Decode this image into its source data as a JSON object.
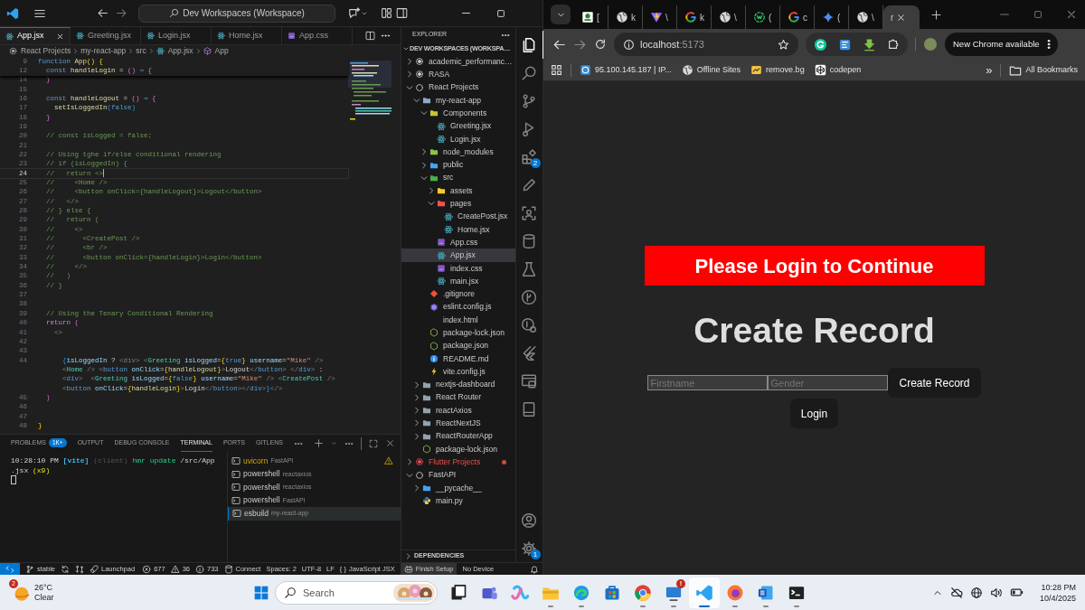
{
  "vscode": {
    "command_center": "Dev Workspaces (Workspace)",
    "tabs": [
      {
        "label": "App.jsx",
        "kind": "react",
        "selected": true
      },
      {
        "label": "Greeting.jsx",
        "kind": "react",
        "selected": false
      },
      {
        "label": "Login.jsx",
        "kind": "react",
        "selected": false
      },
      {
        "label": "Home.jsx",
        "kind": "react",
        "selected": false
      },
      {
        "label": "App.css",
        "kind": "css",
        "selected": false
      }
    ],
    "breadcrumb": [
      {
        "label": "React Projects",
        "kind": "target"
      },
      {
        "label": "my-react-app",
        "kind": "none"
      },
      {
        "label": "src",
        "kind": "none"
      },
      {
        "label": "App.jsx",
        "kind": "react"
      },
      {
        "label": "App",
        "kind": "component"
      }
    ],
    "sticky_lines": [
      {
        "num": "9",
        "current": false,
        "tokens": [
          {
            "text": "function ",
            "kind": "keyword"
          },
          {
            "text": "App",
            "kind": "function"
          },
          {
            "text": "() ",
            "kind": "gold"
          },
          {
            "text": "{",
            "kind": "gold"
          }
        ]
      },
      {
        "num": "12",
        "current": false,
        "tokens": [
          {
            "text": "  const ",
            "kind": "keyword"
          },
          {
            "text": "handleLogin",
            "kind": "function"
          },
          {
            "text": " = ",
            "kind": "plain"
          },
          {
            "text": "() ",
            "kind": "pink"
          },
          {
            "text": "⇒ ",
            "kind": "keyword"
          },
          {
            "text": "{",
            "kind": "pink"
          }
        ]
      }
    ],
    "code_lines": [
      {
        "num": "14",
        "current": false,
        "tokens": [
          {
            "text": "  }",
            "kind": "pink"
          }
        ]
      },
      {
        "num": "15",
        "current": false
      },
      {
        "num": "16",
        "current": false,
        "tokens": [
          {
            "text": "  const ",
            "kind": "keyword"
          },
          {
            "text": "handleLogout",
            "kind": "function"
          },
          {
            "text": " = ",
            "kind": "plain"
          },
          {
            "text": "() ",
            "kind": "pink"
          },
          {
            "text": "⇒ ",
            "kind": "keyword"
          },
          {
            "text": "{",
            "kind": "pink"
          }
        ]
      },
      {
        "num": "17",
        "current": false,
        "tokens": [
          {
            "text": "    setIsLoggedIn",
            "kind": "function"
          },
          {
            "text": "(",
            "kind": "blue"
          },
          {
            "text": "false",
            "kind": "keyword"
          },
          {
            "text": ")",
            "kind": "blue"
          }
        ]
      },
      {
        "num": "18",
        "current": false,
        "tokens": [
          {
            "text": "  }",
            "kind": "pink"
          }
        ]
      },
      {
        "num": "19",
        "current": false
      },
      {
        "num": "20",
        "current": false,
        "tokens": [
          {
            "text": "  // const isLogged = false;",
            "kind": "comment"
          }
        ]
      },
      {
        "num": "21",
        "current": false
      },
      {
        "num": "22",
        "current": false,
        "tokens": [
          {
            "text": "  // Using tghe if/else conditional rendering",
            "kind": "comment"
          }
        ]
      },
      {
        "num": "23",
        "current": false,
        "tokens": [
          {
            "text": "  // if (isLoggedIn) {",
            "kind": "comment"
          }
        ]
      },
      {
        "num": "24",
        "current": true,
        "tokens": [
          {
            "text": "  //   return <>",
            "kind": "comment"
          }
        ]
      },
      {
        "num": "25",
        "current": false,
        "tokens": [
          {
            "text": "  //     <Home />",
            "kind": "comment"
          }
        ]
      },
      {
        "num": "26",
        "current": false,
        "tokens": [
          {
            "text": "  //     <button onClick={handleLogout}>Logout</button>",
            "kind": "comment"
          }
        ]
      },
      {
        "num": "27",
        "current": false,
        "tokens": [
          {
            "text": "  //   </>",
            "kind": "comment"
          }
        ]
      },
      {
        "num": "28",
        "current": false,
        "tokens": [
          {
            "text": "  // } else {",
            "kind": "comment"
          }
        ]
      },
      {
        "num": "29",
        "current": false,
        "tokens": [
          {
            "text": "  //   return (",
            "kind": "comment"
          }
        ]
      },
      {
        "num": "30",
        "current": false,
        "tokens": [
          {
            "text": "  //     <>",
            "kind": "comment"
          }
        ]
      },
      {
        "num": "31",
        "current": false,
        "tokens": [
          {
            "text": "  //       <CreatePost />",
            "kind": "comment"
          }
        ]
      },
      {
        "num": "32",
        "current": false,
        "tokens": [
          {
            "text": "  //       <br />",
            "kind": "comment"
          }
        ]
      },
      {
        "num": "33",
        "current": false,
        "tokens": [
          {
            "text": "  //       <button onClick={handleLogin}>Login</button>",
            "kind": "comment"
          }
        ]
      },
      {
        "num": "34",
        "current": false,
        "tokens": [
          {
            "text": "  //     </>",
            "kind": "comment"
          }
        ]
      },
      {
        "num": "35",
        "current": false,
        "tokens": [
          {
            "text": "  //   )",
            "kind": "comment"
          }
        ]
      },
      {
        "num": "36",
        "current": false,
        "tokens": [
          {
            "text": "  // }",
            "kind": "comment"
          }
        ]
      },
      {
        "num": "37",
        "current": false
      },
      {
        "num": "38",
        "current": false
      },
      {
        "num": "39",
        "current": false,
        "tokens": [
          {
            "text": "  // Using the Tenary Conditional Rendering",
            "kind": "comment"
          }
        ]
      },
      {
        "num": "40",
        "current": false,
        "tokens": [
          {
            "text": "  return ",
            "kind": "control"
          },
          {
            "text": "(",
            "kind": "pink"
          }
        ]
      },
      {
        "num": "41",
        "current": false,
        "tokens": [
          {
            "text": "    <>",
            "kind": "gray"
          }
        ]
      },
      {
        "num": "42",
        "current": false
      },
      {
        "num": "43",
        "current": false
      },
      {
        "num": "44",
        "current": false,
        "tokens": [
          {
            "text": "      {",
            "kind": "blue"
          },
          {
            "text": "isLoggedIn",
            "kind": "variable"
          },
          {
            "text": " ? ",
            "kind": "plain"
          },
          {
            "text": "<div> <",
            "kind": "gray"
          },
          {
            "text": "Greeting",
            "kind": "component"
          },
          {
            "text": " isLogged",
            "kind": "variable"
          },
          {
            "text": "=",
            "kind": "plain"
          },
          {
            "text": "{",
            "kind": "gold"
          },
          {
            "text": "true",
            "kind": "keyword"
          },
          {
            "text": "}",
            "kind": "gold"
          },
          {
            "text": " username",
            "kind": "variable"
          },
          {
            "text": "=",
            "kind": "plain"
          },
          {
            "text": "\"Mike\"",
            "kind": "string"
          },
          {
            "text": " />",
            "kind": "gray"
          }
        ]
      },
      {
        "current": false,
        "tokens": [
          {
            "text": "      <",
            "kind": "gray"
          },
          {
            "text": "Home",
            "kind": "component"
          },
          {
            "text": " /> <",
            "kind": "gray"
          },
          {
            "text": "button",
            "kind": "tag"
          },
          {
            "text": " onClick",
            "kind": "variable"
          },
          {
            "text": "=",
            "kind": "plain"
          },
          {
            "text": "{",
            "kind": "gold"
          },
          {
            "text": "handleLogout",
            "kind": "function"
          },
          {
            "text": "}",
            "kind": "gold"
          },
          {
            "text": ">",
            "kind": "gray"
          },
          {
            "text": "Logout",
            "kind": "plain"
          },
          {
            "text": "</",
            "kind": "gray"
          },
          {
            "text": "button",
            "kind": "tag"
          },
          {
            "text": "> </",
            "kind": "gray"
          },
          {
            "text": "div",
            "kind": "tag"
          },
          {
            "text": ">",
            "kind": "gray"
          },
          {
            "text": " :",
            "kind": "plain"
          }
        ]
      },
      {
        "current": false,
        "tokens": [
          {
            "text": "      <",
            "kind": "gray"
          },
          {
            "text": "div",
            "kind": "tag"
          },
          {
            "text": ">  <",
            "kind": "gray"
          },
          {
            "text": "Greeting",
            "kind": "component"
          },
          {
            "text": " isLogged",
            "kind": "variable"
          },
          {
            "text": "=",
            "kind": "plain"
          },
          {
            "text": "{",
            "kind": "gold"
          },
          {
            "text": "false",
            "kind": "keyword"
          },
          {
            "text": "}",
            "kind": "gold"
          },
          {
            "text": " username",
            "kind": "variable"
          },
          {
            "text": "=",
            "kind": "plain"
          },
          {
            "text": "\"Mike\"",
            "kind": "string"
          },
          {
            "text": " /> <",
            "kind": "gray"
          },
          {
            "text": "CreatePost",
            "kind": "component"
          },
          {
            "text": " />",
            "kind": "gray"
          }
        ]
      },
      {
        "current": false,
        "tokens": [
          {
            "text": "      <",
            "kind": "gray"
          },
          {
            "text": "button",
            "kind": "tag"
          },
          {
            "text": " onClick",
            "kind": "variable"
          },
          {
            "text": "=",
            "kind": "plain"
          },
          {
            "text": "{",
            "kind": "gold"
          },
          {
            "text": "handleLogin",
            "kind": "function"
          },
          {
            "text": "}",
            "kind": "gold"
          },
          {
            "text": ">",
            "kind": "gray"
          },
          {
            "text": "Login",
            "kind": "plain"
          },
          {
            "text": "</",
            "kind": "gray"
          },
          {
            "text": "button",
            "kind": "tag"
          },
          {
            "text": "></",
            "kind": "gray"
          },
          {
            "text": "div",
            "kind": "tag"
          },
          {
            "text": ">",
            "kind": "gray"
          },
          {
            "text": "}",
            "kind": "blue"
          },
          {
            "text": "</>",
            "kind": "gray"
          }
        ]
      },
      {
        "num": "45",
        "current": false,
        "tokens": [
          {
            "text": "  )",
            "kind": "pink"
          }
        ]
      },
      {
        "num": "46",
        "current": false
      },
      {
        "num": "47",
        "current": false
      },
      {
        "num": "48",
        "current": false,
        "tokens": [
          {
            "text": "}",
            "kind": "gold"
          }
        ]
      }
    ],
    "explorer": {
      "title": "EXPLORER",
      "section": "DEV WORKSPACES (WORKSPA…",
      "footer_section": "DEPENDENCIES",
      "tree": [
        {
          "label": "academic_performanc…",
          "kind": "root",
          "expanded": false,
          "error": false,
          "selected": false
        },
        {
          "label": "RASA",
          "kind": "root",
          "expanded": false,
          "error": false,
          "selected": false
        },
        {
          "label": "React Projects",
          "kind": "root",
          "expanded": true,
          "error": false,
          "selected": false,
          "children": [
            {
              "label": "my-react-app",
              "kind": "folder",
              "color": "#8fa9c9",
              "expanded": true,
              "selected": false,
              "children": [
                {
                  "label": "Components",
                  "kind": "folder",
                  "color": "#c0ca33",
                  "expanded": true,
                  "selected": false,
                  "children": [
                    {
                      "label": "Greeting.jsx",
                      "kind": "react",
                      "selected": false
                    },
                    {
                      "label": "Login.jsx",
                      "kind": "react",
                      "selected": false
                    }
                  ]
                },
                {
                  "label": "node_modules",
                  "kind": "folder",
                  "color": "#8bc34a",
                  "expanded": false,
                  "selected": false
                },
                {
                  "label": "public",
                  "kind": "folder",
                  "color": "#42a5f5",
                  "expanded": false,
                  "selected": false
                },
                {
                  "label": "src",
                  "kind": "folder",
                  "color": "#4caf50",
                  "expanded": true,
                  "selected": false,
                  "children": [
                    {
                      "label": "assets",
                      "kind": "folder",
                      "color": "#ffca28",
                      "expanded": false,
                      "selected": false
                    },
                    {
                      "label": "pages",
                      "kind": "folder",
                      "color": "#ef5350",
                      "expanded": true,
                      "selected": false,
                      "children": [
                        {
                          "label": "CreatePost.jsx",
                          "kind": "react",
                          "selected": false
                        },
                        {
                          "label": "Home.jsx",
                          "kind": "react",
                          "selected": false
                        }
                      ]
                    },
                    {
                      "label": "App.css",
                      "kind": "css",
                      "selected": false
                    },
                    {
                      "label": "App.jsx",
                      "kind": "react",
                      "selected": true
                    },
                    {
                      "label": "index.css",
                      "kind": "css",
                      "selected": false
                    },
                    {
                      "label": "main.jsx",
                      "kind": "react",
                      "selected": false
                    }
                  ]
                },
                {
                  "label": ".gitignore",
                  "kind": "git",
                  "selected": false
                },
                {
                  "label": "eslint.config.js",
                  "kind": "eslint",
                  "selected": false
                },
                {
                  "label": "index.html",
                  "kind": "html",
                  "selected": false
                },
                {
                  "label": "package-lock.json",
                  "kind": "npm",
                  "selected": false
                },
                {
                  "label": "package.json",
                  "kind": "npm",
                  "selected": false
                },
                {
                  "label": "README.md",
                  "kind": "info",
                  "selected": false
                },
                {
                  "label": "vite.config.js",
                  "kind": "vite",
                  "selected": false
                }
              ]
            },
            {
              "label": "nextjs-dashboard",
              "kind": "folder",
              "color": "#90a4ae",
              "expanded": false,
              "selected": false
            },
            {
              "label": "React Router",
              "kind": "folder",
              "color": "#90a4ae",
              "expanded": false,
              "selected": false
            },
            {
              "label": "reactAxios",
              "kind": "folder",
              "color": "#90a4ae",
              "expanded": false,
              "selected": false
            },
            {
              "label": "ReactNextJS",
              "kind": "folder",
              "color": "#90a4ae",
              "expanded": false,
              "selected": false
            },
            {
              "label": "ReactRouterApp",
              "kind": "folder",
              "color": "#90a4ae",
              "expanded": false,
              "selected": false
            },
            {
              "label": "package-lock.json",
              "kind": "npm",
              "selected": false
            }
          ]
        },
        {
          "label": "Flutter Projects",
          "kind": "root",
          "expanded": false,
          "error": true,
          "selected": false
        },
        {
          "label": "FastAPI",
          "kind": "root",
          "expanded": true,
          "error": false,
          "selected": false,
          "children": [
            {
              "label": "__pycache__",
              "kind": "folder",
              "color": "#42a5f5",
              "expanded": false,
              "selected": false
            },
            {
              "label": "main.py",
              "kind": "python",
              "selected": false
            }
          ]
        }
      ]
    },
    "activity_bar": {
      "top": [
        {
          "kind": "files",
          "selected": true
        },
        {
          "kind": "search",
          "selected": false
        },
        {
          "kind": "scm",
          "selected": false
        },
        {
          "kind": "debug",
          "selected": false
        },
        {
          "kind": "ext",
          "selected": false,
          "badge": "2"
        },
        {
          "kind": "edit",
          "selected": false
        },
        {
          "kind": "scan",
          "selected": false
        },
        {
          "kind": "db",
          "selected": false
        },
        {
          "kind": "flask",
          "selected": false
        },
        {
          "kind": "gitgraph",
          "selected": false
        },
        {
          "kind": "remote",
          "selected": false
        },
        {
          "kind": "flutter",
          "selected": false
        },
        {
          "kind": "container",
          "selected": false
        },
        {
          "kind": "book",
          "selected": false
        }
      ],
      "bottom": [
        {
          "kind": "account",
          "selected": false
        },
        {
          "kind": "gear",
          "selected": false,
          "badge": "1"
        }
      ]
    },
    "panel": {
      "tabs": [
        {
          "label": "PROBLEMS",
          "badge": "1K+",
          "selected": false
        },
        {
          "label": "OUTPUT",
          "selected": false
        },
        {
          "label": "DEBUG CONSOLE",
          "selected": false
        },
        {
          "label": "TERMINAL",
          "selected": true
        },
        {
          "label": "PORTS",
          "selected": false
        },
        {
          "label": "GITLENS",
          "selected": false
        }
      ],
      "terminal_lines": [
        [
          {
            "text": "10:28:10 PM ",
            "kind": "plain"
          },
          {
            "text": "[vite]",
            "kind": "tag"
          },
          {
            "text": " (client)",
            "kind": "dim"
          },
          {
            "text": " hmr update",
            "kind": "ok"
          },
          {
            "text": " /src/App",
            "kind": "plain"
          }
        ],
        [
          {
            "text": ".jsx",
            "kind": "plain"
          },
          {
            "text": " (x9)",
            "kind": "count"
          }
        ]
      ],
      "terminals": [
        {
          "name": "uvicorn",
          "folder": "FastAPI",
          "warning": true,
          "selected": false
        },
        {
          "name": "powershell",
          "folder": "reactaxios",
          "warning": false,
          "selected": false
        },
        {
          "name": "powershell",
          "folder": "reactaxios",
          "warning": false,
          "selected": false
        },
        {
          "name": "powershell",
          "folder": "FastAPI",
          "warning": false,
          "selected": false
        },
        {
          "name": "esbuild",
          "folder": "my-react-app",
          "warning": false,
          "selected": true
        }
      ]
    },
    "status_bar": [
      {
        "kind": "remote"
      },
      {
        "kind": "branch",
        "text": "stable"
      },
      {
        "kind": "sync"
      },
      {
        "kind": "graph"
      },
      {
        "kind": "rocket",
        "text": "Launchpad"
      },
      {
        "kind": "error",
        "text": "677"
      },
      {
        "kind": "warning",
        "text": "36"
      },
      {
        "kind": "infoc",
        "text": "733"
      },
      {
        "kind": "db",
        "text": "Connect"
      },
      {
        "kind": "plain",
        "text": "Spaces: 2"
      },
      {
        "kind": "plain",
        "text": "UTF-8"
      },
      {
        "kind": "plain",
        "text": "LF"
      },
      {
        "kind": "language",
        "icon": "{ }",
        "text": "JavaScript JSX"
      },
      {
        "kind": "copilot",
        "text": "Finish Setup"
      },
      {
        "kind": "plain",
        "text": "No Device"
      },
      {
        "kind": "bell"
      }
    ]
  },
  "chrome": {
    "tabs": [
      {
        "title": "[",
        "kind": "app",
        "selected": false
      },
      {
        "title": "k",
        "kind": "globe",
        "selected": false
      },
      {
        "title": "\\",
        "kind": "vite",
        "selected": false
      },
      {
        "title": "k",
        "kind": "google",
        "selected": false
      },
      {
        "title": "\\",
        "kind": "globe",
        "selected": false
      },
      {
        "title": "(",
        "kind": "ring",
        "selected": false
      },
      {
        "title": "c",
        "kind": "google",
        "selected": false
      },
      {
        "title": "(",
        "kind": "gemini",
        "selected": false
      },
      {
        "title": "\\",
        "kind": "globe",
        "selected": false
      },
      {
        "title": "r",
        "kind": "none",
        "selected": true
      }
    ],
    "address": {
      "host": "localhost",
      "port": ":5173"
    },
    "update_button": "New Chrome available",
    "bookmarks": [
      {
        "label": "95.100.145.187 | IP...",
        "kind": "ipfav"
      },
      {
        "label": "Offline Sites",
        "kind": "globe"
      },
      {
        "label": "remove.bg",
        "kind": "removebg"
      },
      {
        "label": "codepen",
        "kind": "codepen"
      }
    ],
    "more_bookmarks": "»",
    "all_bookmarks": "All Bookmarks"
  },
  "page": {
    "banner": "Please Login to Continue",
    "heading": "Create Record",
    "fields": [
      {
        "placeholder": "Firstname"
      },
      {
        "placeholder": "Gender"
      }
    ],
    "create_button": "Create Record",
    "login_button": "Login"
  },
  "taskbar": {
    "weather": {
      "badge": "2",
      "temperature": "26°C",
      "condition": "Clear"
    },
    "search_placeholder": "Search",
    "apps": [
      {
        "kind": "taskview",
        "running": false,
        "selected": false
      },
      {
        "kind": "teams",
        "running": false,
        "selected": false
      },
      {
        "kind": "copilotapp",
        "running": false,
        "selected": false
      },
      {
        "kind": "filesapp",
        "running": true,
        "selected": false
      },
      {
        "kind": "edge",
        "running": true,
        "selected": false
      },
      {
        "kind": "store",
        "running": false,
        "selected": false
      },
      {
        "kind": "chrome",
        "running": true,
        "selected": false
      },
      {
        "kind": "remoteapp",
        "running": true,
        "selected": false,
        "badge": "!"
      },
      {
        "kind": "logo",
        "running": true,
        "selected": true
      },
      {
        "kind": "firefox",
        "running": true,
        "selected": false
      },
      {
        "kind": "word",
        "running": true,
        "selected": false
      },
      {
        "kind": "termapp",
        "running": true,
        "selected": false
      }
    ],
    "time": "10:28 PM",
    "date": "10/4/2025"
  }
}
